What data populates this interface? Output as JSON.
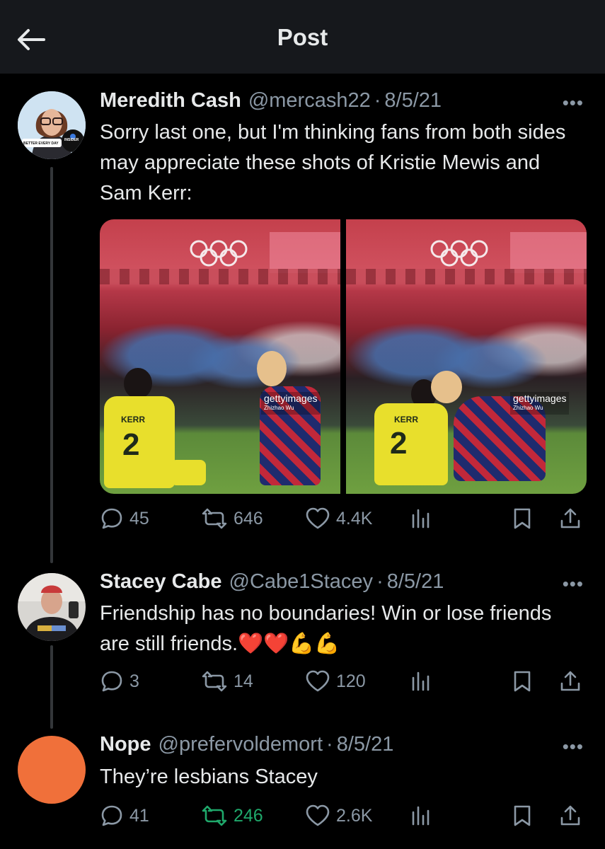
{
  "header": {
    "title": "Post"
  },
  "posts": [
    {
      "name": "Meredith Cash",
      "handle": "@mercash22",
      "dot": "·",
      "date": "8/5/21",
      "more": "•••",
      "text": "Sorry last one, but I'm thinking fans from both sides may appreciate these shots of Kristie Mewis and Sam Kerr:",
      "avatar_text": {
        "left": "BETTER EVERY DAY",
        "right": "INSIDER"
      },
      "media": [
        {
          "jersey_name": "KERR",
          "jersey_number": "2",
          "watermark": "gettyimages",
          "credit": "Zhizhao Wu"
        },
        {
          "jersey_name": "KERR",
          "jersey_number": "2",
          "watermark": "gettyimages",
          "credit": "Zhizhao Wu"
        }
      ],
      "stats": {
        "replies": "45",
        "reposts": "646",
        "likes": "4.4K"
      }
    },
    {
      "name": "Stacey Cabe",
      "handle": "@Cabe1Stacey",
      "dot": "·",
      "date": "8/5/21",
      "more": "•••",
      "text": "Friendship has no boundaries! Win or lose friends are still friends.❤️❤️💪💪",
      "stats": {
        "replies": "3",
        "reposts": "14",
        "likes": "120"
      }
    },
    {
      "name": "Nope",
      "handle": "@prefervoldemort",
      "dot": "·",
      "date": "8/5/21",
      "more": "•••",
      "text": "They’re lesbians Stacey",
      "stats": {
        "replies": "41",
        "reposts": "246",
        "likes": "2.6K"
      }
    }
  ],
  "colors": {
    "background": "#000000",
    "header": "#16181c",
    "muted": "#8b98a5",
    "text": "#e7e9ea",
    "repost_active": "#1fa86b",
    "avatar_orange": "#f0703a"
  },
  "icons": [
    "back-arrow-icon",
    "more-icon",
    "reply-icon",
    "repost-icon",
    "like-icon",
    "views-icon",
    "bookmark-icon",
    "share-icon"
  ]
}
